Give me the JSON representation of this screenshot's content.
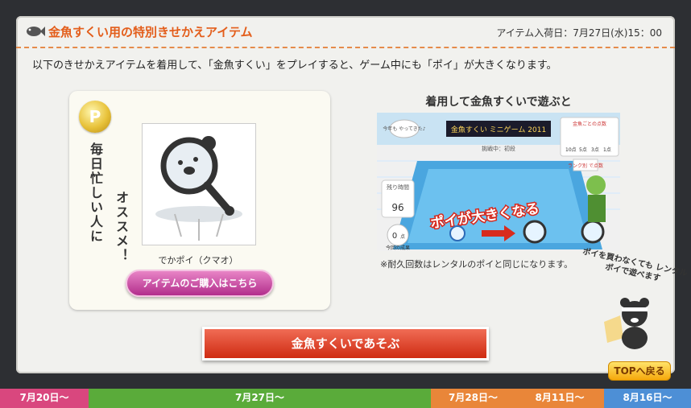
{
  "header": {
    "title": "金魚すくい用の特別きせかえアイテム",
    "arrival": "アイテム入荷日：7月27日(水)15：00"
  },
  "intro": "以下のきせかえアイテムを着用して、「金魚すくい」をプレイすると、ゲーム中にも「ポイ」が大きくなります。",
  "left_panel": {
    "coin_letter": "P",
    "vertical_text_1": "毎日忙しい人に",
    "vertical_text_2": "オススメ！",
    "item_name": "でかポイ（クマオ）",
    "buy_label": "アイテムのご購入はこちら"
  },
  "right_panel": {
    "heading": "着用して金魚すくいで遊ぶと",
    "note": "※耐久回数はレンタルのポイと同じになります。",
    "screenshot": {
      "game_title": "金魚すくい ミニゲーム 2011",
      "status": "挑戦中：初段",
      "speech": "今年も やってきた♪",
      "time_label": "残り時間",
      "time_value": "96",
      "score_value": "0",
      "score_unit": "点",
      "score_caption": "今回の成果",
      "banner": "ポイが大きくなる",
      "table_title": "金魚ごとの点数",
      "table_values": [
        "10点",
        "5点",
        "3点",
        "1点"
      ],
      "side_sign": "ランク別 で点数"
    }
  },
  "play_label": "金魚すくいであそぶ",
  "bubble_text": "ポイを買わなくても レンタルポイで遊べます",
  "top_label": "TOPへ戻る",
  "tabs": [
    {
      "label": "7月20日～",
      "color": "#d9477e"
    },
    {
      "label": "7月27日～",
      "color": "#5aab3a"
    },
    {
      "label": "7月28日～",
      "color": "#e98639"
    },
    {
      "label": "8月11日～",
      "color": "#e98639"
    },
    {
      "label": "8月16日～",
      "color": "#4d8fd6"
    }
  ]
}
